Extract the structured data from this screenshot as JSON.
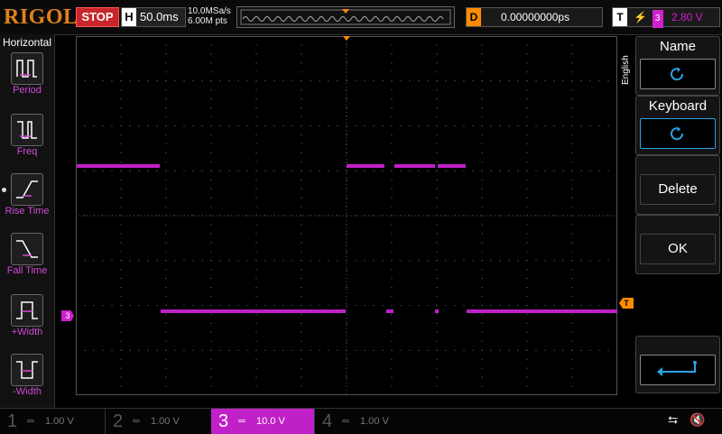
{
  "brand": "RIGOL",
  "run_state": "STOP",
  "timebase": {
    "key": "H",
    "value": "50.0ms"
  },
  "sample": {
    "rate": "10.0MSa/s",
    "points": "6.00M pts"
  },
  "trigger_position": {
    "key": "D",
    "value": "0.00000000ps"
  },
  "trigger": {
    "key": "T",
    "channel": "3",
    "level": "2.80 V"
  },
  "left_menu": {
    "title": "Horizontal",
    "items": [
      {
        "label": "Period",
        "icon": "period-icon"
      },
      {
        "label": "Freq",
        "icon": "freq-icon"
      },
      {
        "label": "Rise Time",
        "icon": "rise-time-icon"
      },
      {
        "label": "Fall Time",
        "icon": "fall-time-icon"
      },
      {
        "label": "+Width",
        "icon": "pos-width-icon"
      },
      {
        "label": "-Width",
        "icon": "neg-width-icon"
      }
    ]
  },
  "right_menu": {
    "language": "English",
    "items": [
      {
        "label": "Name",
        "icon": "refresh-icon"
      },
      {
        "label": "Keyboard",
        "icon": "refresh-icon"
      },
      {
        "label": "Delete"
      },
      {
        "label": "OK"
      },
      {
        "label": "",
        "icon": "enter-icon"
      }
    ]
  },
  "channels": [
    {
      "num": "1",
      "scale": "1.00 V",
      "active": false,
      "color": "#d8d030"
    },
    {
      "num": "2",
      "scale": "1.00 V",
      "active": false,
      "color": "#30d8d8"
    },
    {
      "num": "3",
      "scale": "10.0 V",
      "active": true,
      "color": "#d020d0"
    },
    {
      "num": "4",
      "scale": "1.00 V",
      "active": false,
      "color": "#3080e0"
    }
  ],
  "channel3_marker": "3",
  "trigger_marker": "T",
  "colors": {
    "ch3": "#c020c8",
    "trigger": "#ff8c00",
    "highlight": "#2aa3e6"
  }
}
